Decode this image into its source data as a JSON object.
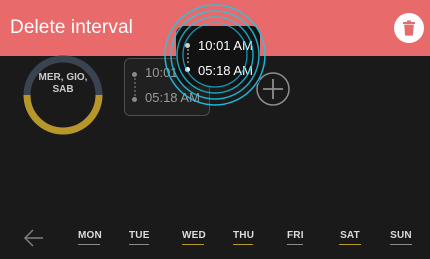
{
  "header": {
    "title": "Delete interval",
    "background_color": "#e86a6b",
    "delete_icon": "trash-icon"
  },
  "schedule": {
    "days_label_line1": "MER, GIO,",
    "days_label_line2": "SAB",
    "ring_track_color": "#3a4350",
    "ring_active_color": "#b8972a"
  },
  "interval_card": {
    "start": "10:01 AM",
    "end": "05:18 AM"
  },
  "popup": {
    "start": "10:01 AM",
    "end": "05:18 AM",
    "highlight_color": "#1ec8e8"
  },
  "add_button": {
    "icon": "plus-circle-icon"
  },
  "footer": {
    "back_icon": "arrow-left-icon",
    "days": [
      {
        "label": "MON",
        "selected": false
      },
      {
        "label": "TUE",
        "selected": false
      },
      {
        "label": "WED",
        "selected": true
      },
      {
        "label": "THU",
        "selected": true
      },
      {
        "label": "FRI",
        "selected": false
      },
      {
        "label": "SAT",
        "selected": true
      },
      {
        "label": "SUN",
        "selected": false
      }
    ],
    "selected_color": "#b59a2a"
  }
}
